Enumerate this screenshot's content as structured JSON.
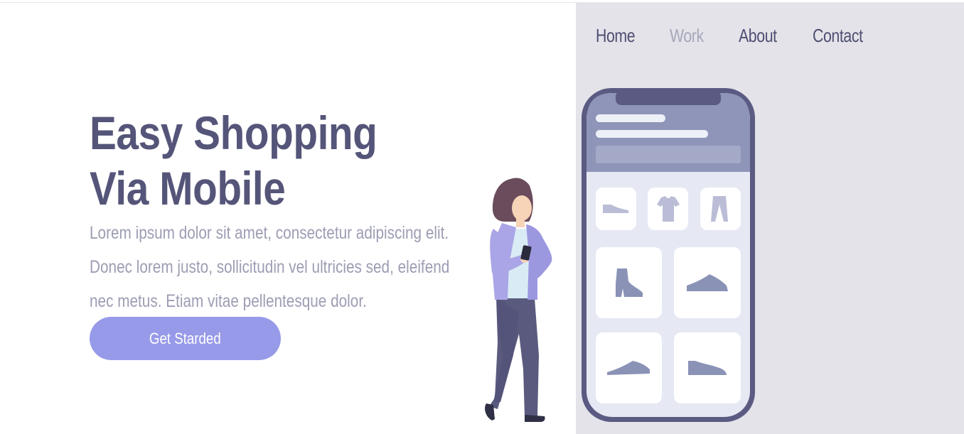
{
  "nav": {
    "items": [
      {
        "label": "Home",
        "active": false
      },
      {
        "label": "Work",
        "active": true
      },
      {
        "label": "About",
        "active": false
      },
      {
        "label": "Contact",
        "active": false
      }
    ]
  },
  "hero": {
    "title_line1": "Easy Shopping",
    "title_line2": "Via Mobile",
    "description": "Lorem ipsum dolor sit amet, consectetur adipiscing elit. Donec lorem justo, sollicitudin vel ultricies sed, eleifend nec metus. Etiam vitae pellentesque dolor.",
    "cta_label": "Get Starded"
  },
  "illustration": {
    "phone_categories": [
      "shoe-icon",
      "t-shirt-icon",
      "pants-icon"
    ],
    "phone_products": [
      "boot-icon",
      "sneaker-icon",
      "sneaker-icon",
      "sneaker-icon"
    ]
  },
  "colors": {
    "accent": "#979ae8",
    "heading": "#55557a",
    "body_text": "#9c9db3",
    "nav_text": "#4e4f73",
    "nav_active": "#a6a7bb",
    "panel_bg": "#e4e3e9",
    "phone_frame": "#5a5a82"
  }
}
